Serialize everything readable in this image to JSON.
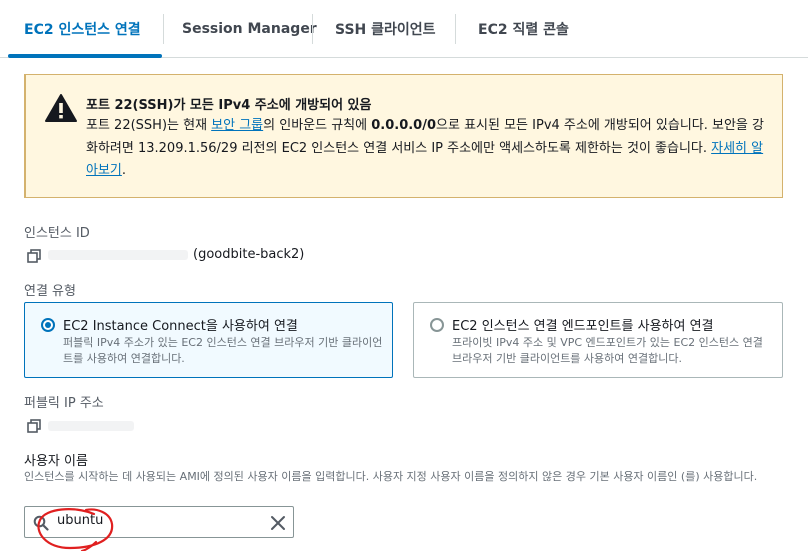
{
  "tabs": [
    {
      "label": "EC2 인스턴스 연결",
      "active": true
    },
    {
      "label": "Session Manager"
    },
    {
      "label": "SSH 클라이언트"
    },
    {
      "label": "EC2 직렬 콘솔"
    }
  ],
  "alert": {
    "title": "포트 22(SSH)가 모든 IPv4 주소에 개방되어 있음",
    "body_part1": "포트 22(SSH)는 현재 ",
    "security_group_link": "보안 그룹",
    "body_part2": "의 인바운드 규칙에 ",
    "cidr": "0.0.0.0/0",
    "body_part3": "으로 표시된 모든 IPv4 주소에 개방되어 있습니다. 보안을 강화하려면 13.209.1.56/29 리전의 EC2 인스턴스 연결 서비스 IP 주소에만 액세스하도록 제한하는 것이 좋습니다. ",
    "learn_more_link": "자세히 알아보기",
    "body_end": "."
  },
  "instance": {
    "label": "인스턴스 ID",
    "name": "(goodbite-back2)"
  },
  "connection_type": {
    "label": "연결 유형",
    "options": [
      {
        "title": "EC2 Instance Connect을 사용하여 연결",
        "description": "퍼블릭 IPv4 주소가 있는 EC2 인스턴스 연결 브라우저 기반 클라이언트를 사용하여 연결합니다.",
        "selected": true
      },
      {
        "title": "EC2 인스턴스 연결 엔드포인트를 사용하여 연결",
        "description": "프라이빗 IPv4 주소 및 VPC 엔드포인트가 있는 EC2 인스턴스 연결 브라우저 기반 클라이언트를 사용하여 연결합니다.",
        "selected": false
      }
    ]
  },
  "public_ip": {
    "label": "퍼블릭 IP 주소"
  },
  "username": {
    "label": "사용자 이름",
    "help": "인스턴스를 시작하는 데 사용되는 AMI에 정의된 사용자 이름을 입력합니다. 사용자 지정 사용자 이름을 정의하지 않은 경우 기본 사용자 이름인 (를) 사용합니다.",
    "value": "ubuntu"
  },
  "colors": {
    "accent": "#0073bb",
    "warning_bg": "#fff7e0",
    "warning_border": "#d4b26d",
    "annotation": "#e02020"
  }
}
